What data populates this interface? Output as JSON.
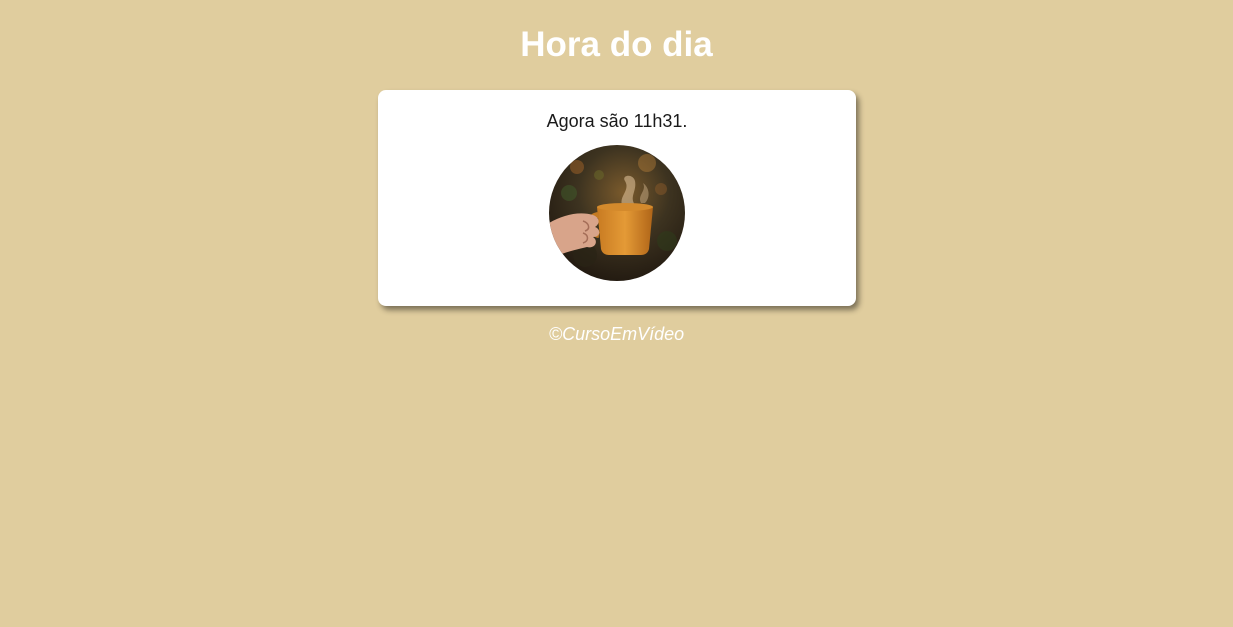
{
  "header": {
    "title": "Hora do dia"
  },
  "card": {
    "message": "Agora são 11h31.",
    "image_subject": "coffee-cup-photo"
  },
  "footer": {
    "text": "©CursoEmVídeo"
  },
  "colors": {
    "background": "#e0cd9e",
    "card": "#ffffff",
    "title_text": "#ffffff",
    "body_text": "#1a1a1a"
  }
}
